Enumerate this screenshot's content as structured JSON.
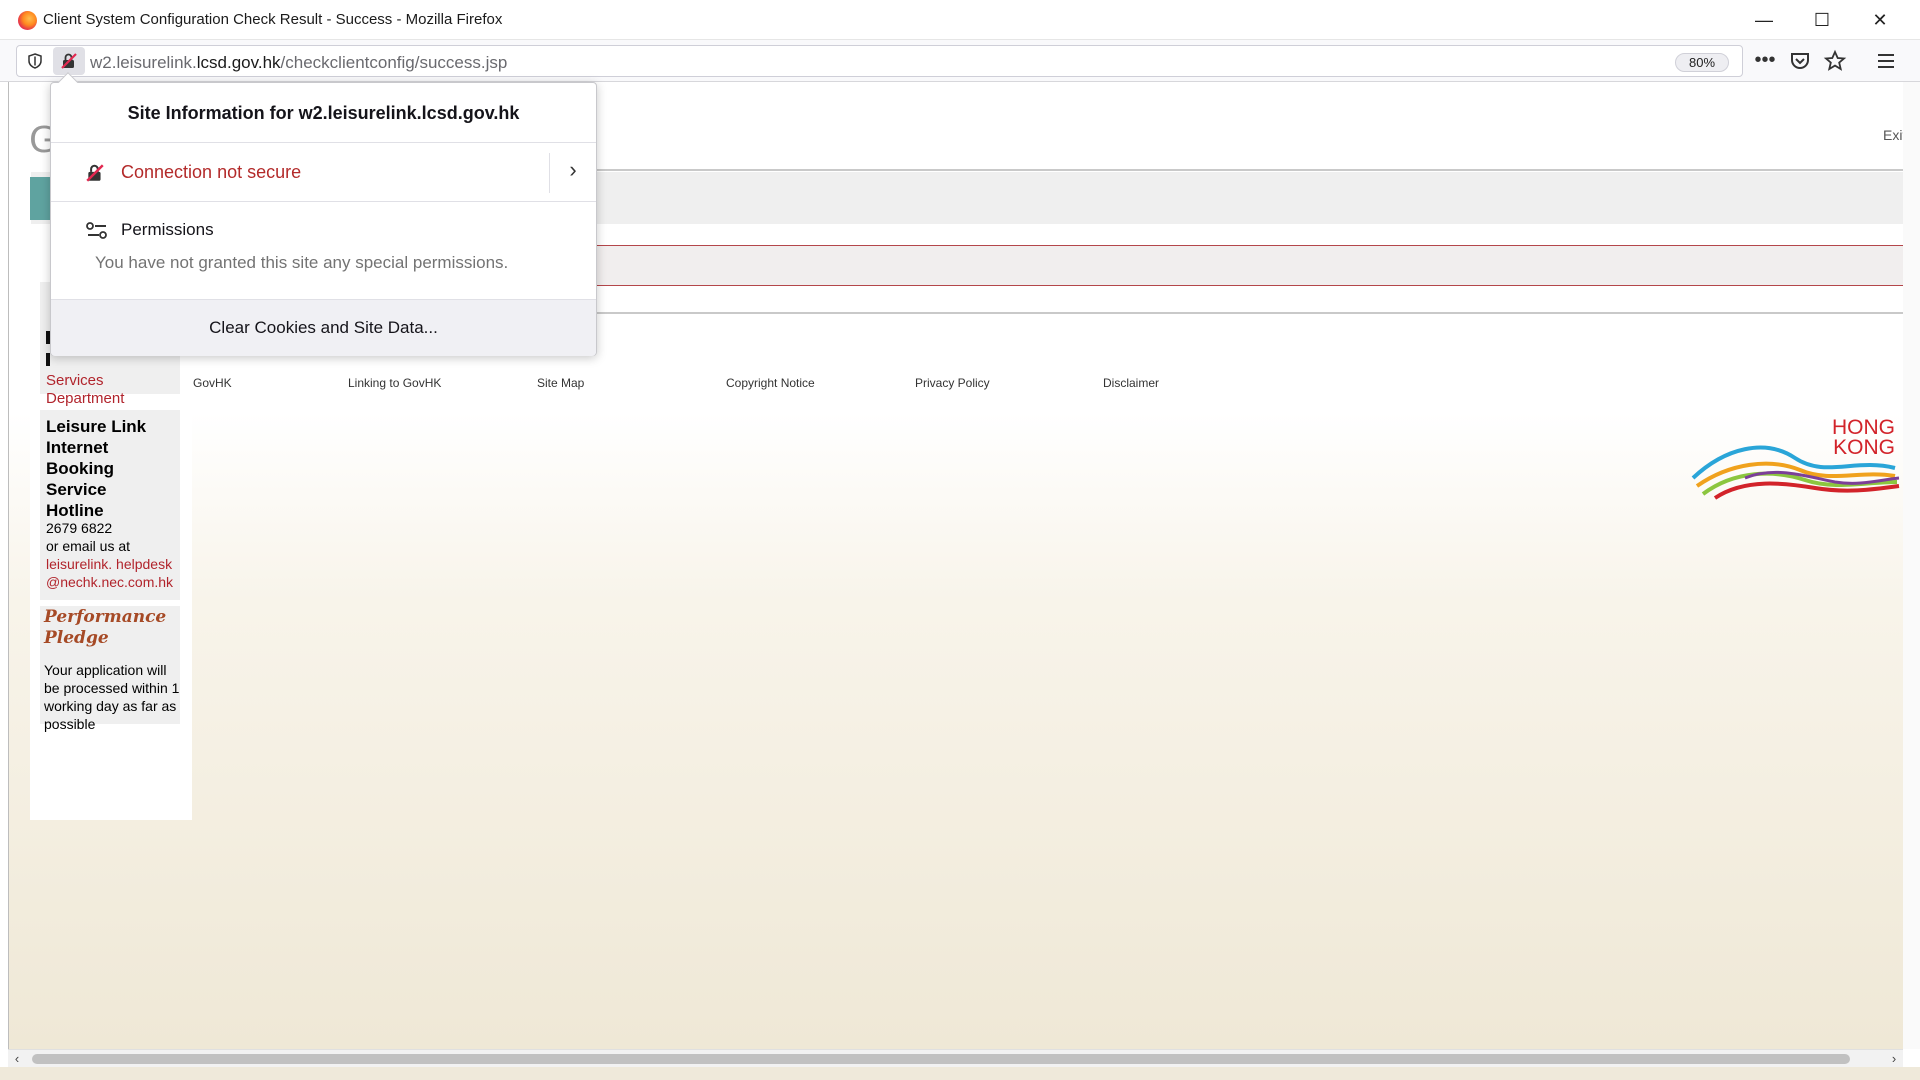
{
  "window": {
    "title": "Client System Configuration Check Result - Success - Mozilla Firefox",
    "controls": {
      "minimize": "—",
      "maximize": "☐",
      "close": "✕"
    }
  },
  "navbar": {
    "url_prefix": "w2.leisurelink.",
    "url_domain": "lcsd.gov.hk",
    "url_path": "/checkclientconfig/success.jsp",
    "zoom": "80%",
    "icons": [
      "tracking-shield-icon",
      "insecure-lock-icon",
      "page-actions-icon",
      "pocket-icon",
      "bookmark-star-icon",
      "hamburger-menu-icon"
    ]
  },
  "popup": {
    "header": "Site Information for w2.leisurelink.lcsd.gov.hk",
    "connection": "Connection not secure",
    "permissions_label": "Permissions",
    "permissions_desc": "You have not granted this site any special permissions.",
    "clear_button": "Clear Cookies and Site Data..."
  },
  "page": {
    "exit": "Exit",
    "g_letter": "G",
    "lcsd_text_line1": "Services",
    "lcsd_text_line2": "Department",
    "hotline": {
      "h1": "Leisure Link",
      "h2": "Internet",
      "h3": "Booking",
      "h4": "Service",
      "h5": "Hotline",
      "phone": "2679 6822",
      "email_intro": "or email us at",
      "email_1": "leisurelink. helpdesk",
      "email_2": "@nechk.nec.com.hk"
    },
    "pledge": {
      "h1": "Performance",
      "h2": "Pledge",
      "text": "Your application will be processed within 1 working day as far as possible"
    },
    "footer_links": [
      "GovHK",
      "Linking to GovHK",
      "Site Map",
      "Copyright Notice",
      "Privacy Policy",
      "Disclaimer"
    ],
    "logo_text_1": "HONG",
    "logo_text_2": "KONG"
  },
  "colors": {
    "accent_red": "#b1242c",
    "teal": "#5fa3a0",
    "page_bg_bottom": "#efe8d6"
  }
}
